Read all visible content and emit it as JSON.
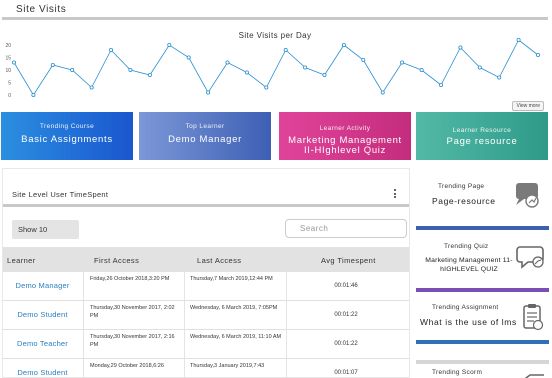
{
  "site_visits": {
    "title": "Site Visits",
    "view_more": "View more",
    "chart_data": {
      "type": "line",
      "title": "Site Visits per Day",
      "xlabel": "",
      "ylabel": "",
      "ylim": [
        0,
        20
      ],
      "yticks": [
        0,
        5,
        10,
        15,
        20
      ],
      "grid": false,
      "color": "#2a8fd0",
      "values": [
        13,
        0,
        12,
        10,
        3,
        18,
        10,
        8,
        20,
        15,
        1,
        13,
        9,
        3,
        18,
        11,
        8,
        20,
        14,
        1,
        13,
        10,
        4,
        19,
        11,
        7,
        22,
        16
      ]
    }
  },
  "cards": [
    {
      "sub": "Trending Course",
      "main": "Basic Assignments",
      "color": "#1a56cf"
    },
    {
      "sub": "Top Learner",
      "main": "Demo Manager",
      "color": "#3d5fb4"
    },
    {
      "sub": "Learner Activity",
      "main": "Marketing Management II-HIghlevel Quiz",
      "color": "#c42c7d"
    },
    {
      "sub": "Learner Resource",
      "main": "Page resource",
      "color": "#2f9a88"
    }
  ],
  "timespent": {
    "title": "Site Level User TimeSpent",
    "show": "Show 10",
    "search_placeholder": "Search",
    "columns": [
      "Learner",
      "First Access",
      "Last Access",
      "Avg Timespent"
    ],
    "rows": [
      {
        "learner": "Demo Manager",
        "first": "Friday,26 October 2018,3:20 PM",
        "last": "Thursday,7 March 2019,12:44 PM",
        "avg": "00:01:46"
      },
      {
        "learner": "Demo Student",
        "first": "Thursday,30 November 2017, 2:02 PM",
        "last": "Wednesday, 6 March 2019, 7:05PM",
        "avg": "00:01:22"
      },
      {
        "learner": "Demo Teacher",
        "first": "Thursday,30 November 2017, 2:16 PM",
        "last": "Wednesday, 6 March 2019, 11:10 AM",
        "avg": "00:01:22"
      },
      {
        "learner": "Demo Student",
        "first": "Monday,29 October 2018,6:26",
        "last": "Thursday,3 January 2019,7:43",
        "avg": "00:01:07"
      }
    ]
  },
  "trending": [
    {
      "label": "Trending Page",
      "value": "Page-resource",
      "icon": "page-icon",
      "color": "#3d5fb4"
    },
    {
      "label": "Trending Quiz",
      "value": "Marketing Management 11-hIGHLEVEL QUIZ",
      "icon": "quiz-chat-icon",
      "color": "#7a4fb5"
    },
    {
      "label": "Trending Assignment",
      "value": "What is the use of lms",
      "icon": "assignment-icon",
      "color": "#2f6fb8"
    },
    {
      "label": "Trending Scorm",
      "value": "",
      "icon": "scorm-icon",
      "color": "#2f9a88"
    }
  ]
}
